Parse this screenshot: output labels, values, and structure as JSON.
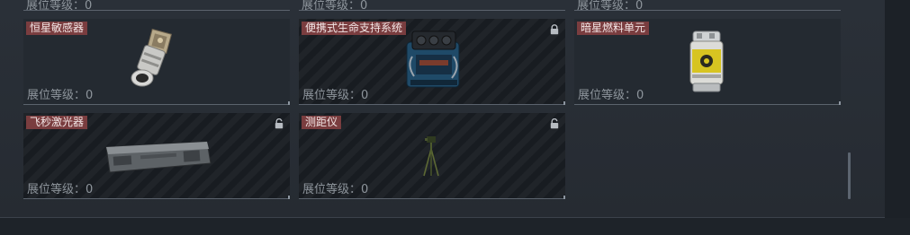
{
  "level_label": "展位等级：",
  "items": [
    {
      "name": "恒星敏感器",
      "level": "0",
      "locked": false,
      "icon": "star-sensor-icon"
    },
    {
      "name": "便携式生命支持系统",
      "level": "0",
      "locked": true,
      "icon": "life-support-icon"
    },
    {
      "name": "暗星燃料单元",
      "level": "0",
      "locked": false,
      "icon": "fuel-cell-icon"
    },
    {
      "name": "飞秒激光器",
      "level": "0",
      "locked": true,
      "icon": "laser-icon"
    },
    {
      "name": "测距仪",
      "level": "0",
      "locked": true,
      "icon": "rangefinder-icon"
    }
  ],
  "top_row_levels": [
    "0",
    "0",
    "0"
  ],
  "colors": {
    "tag_bg": "#7a3d3f",
    "card_bg": "#242a31",
    "card_dark_bg": "#181c21",
    "text_muted": "#8e959c"
  }
}
